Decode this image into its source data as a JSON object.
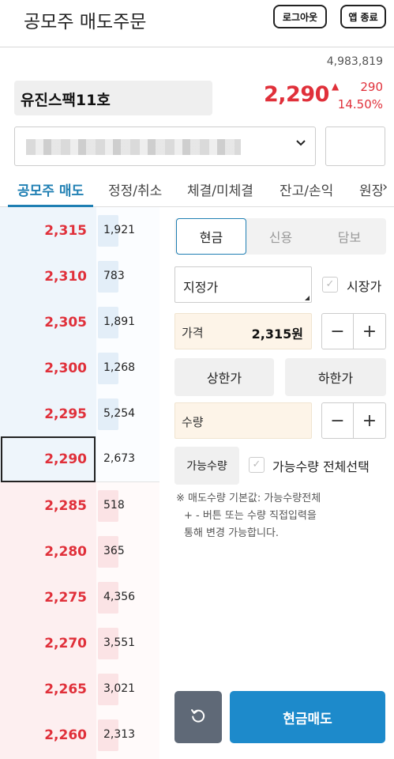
{
  "header": {
    "title": "공모주 매도주문",
    "logout_label": "로그아웃",
    "app_close_label": "앱 종료"
  },
  "stock": {
    "volume": "4,983,819",
    "name": "유진스팩11호",
    "price": "2,290",
    "change": "290",
    "change_rate": "14.50%",
    "up_symbol": "▲",
    "up_color": "#e0303a"
  },
  "account": {
    "dropdown_icon": "chevron-down-icon"
  },
  "tabs": [
    {
      "label": "공모주 매도",
      "active": true
    },
    {
      "label": "정정/취소",
      "active": false
    },
    {
      "label": "체결/미체결",
      "active": false
    },
    {
      "label": "잔고/손익",
      "active": false
    },
    {
      "label": "원장",
      "active": false
    }
  ],
  "tabs_more": "›",
  "orderbook": {
    "asks": [
      {
        "price": "2,315",
        "qty": "1,921"
      },
      {
        "price": "2,310",
        "qty": "783"
      },
      {
        "price": "2,305",
        "qty": "1,891"
      },
      {
        "price": "2,300",
        "qty": "1,268"
      },
      {
        "price": "2,295",
        "qty": "5,254"
      },
      {
        "price": "2,290",
        "qty": "2,673"
      }
    ],
    "bids": [
      {
        "price": "2,285",
        "qty": "518"
      },
      {
        "price": "2,280",
        "qty": "365"
      },
      {
        "price": "2,275",
        "qty": "4,356"
      },
      {
        "price": "2,270",
        "qty": "3,551"
      },
      {
        "price": "2,265",
        "qty": "3,021"
      },
      {
        "price": "2,260",
        "qty": "2,313"
      }
    ]
  },
  "order": {
    "segments": [
      "현금",
      "신용",
      "담보"
    ],
    "active_segment": "현금",
    "order_type": "지정가",
    "market_price_label": "시장가",
    "price_label": "가격",
    "price_value": "2,315원",
    "upper_limit_label": "상한가",
    "lower_limit_label": "하한가",
    "qty_label": "수량",
    "qty_value": "",
    "minus": "−",
    "plus": "+",
    "available_qty_label": "가능수량",
    "select_all_label": "가능수량 전체선택",
    "note_line1": "※ 매도수량 기본값: 가능수량전체",
    "note_line2": "+ - 버튼 또는 수량 직접입력을",
    "note_line3": "통해 변경 가능합니다.",
    "reset_icon": "refresh-icon",
    "submit_label": "현금매도",
    "accent_color": "#1d8acb"
  }
}
